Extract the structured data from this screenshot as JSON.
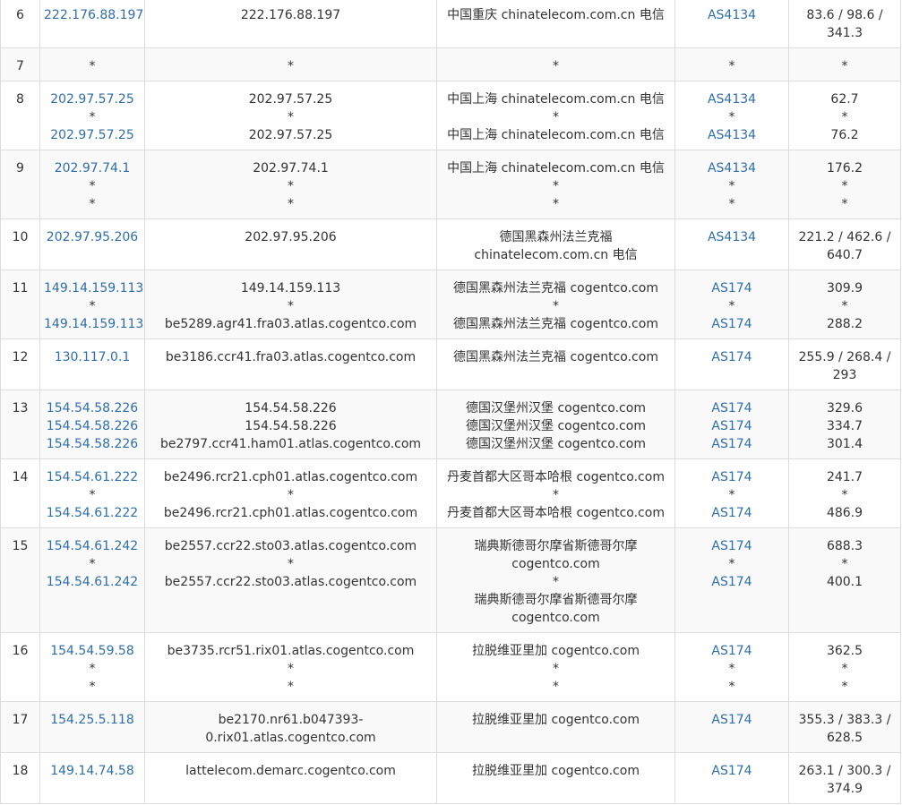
{
  "rows": [
    {
      "hop": "6",
      "ips": [
        "222.176.88.197"
      ],
      "hosts": [
        "222.176.88.197"
      ],
      "locs": [
        "中国重庆 chinatelecom.com.cn 电信"
      ],
      "asns": [
        "AS4134"
      ],
      "rtts": [
        "83.6 / 98.6 / 341.3"
      ]
    },
    {
      "hop": "7",
      "ips": [
        "*"
      ],
      "hosts": [
        "*"
      ],
      "locs": [
        "*"
      ],
      "asns": [
        "*"
      ],
      "rtts": [
        "*"
      ]
    },
    {
      "hop": "8",
      "ips": [
        "202.97.57.25",
        "*",
        "202.97.57.25"
      ],
      "hosts": [
        "202.97.57.25",
        "*",
        "202.97.57.25"
      ],
      "locs": [
        "中国上海 chinatelecom.com.cn 电信",
        "*",
        "中国上海 chinatelecom.com.cn 电信"
      ],
      "asns": [
        "AS4134",
        "*",
        "AS4134"
      ],
      "rtts": [
        "62.7",
        "*",
        "76.2"
      ]
    },
    {
      "hop": "9",
      "ips": [
        "202.97.74.1",
        "*",
        "*"
      ],
      "hosts": [
        "202.97.74.1",
        "*",
        "*"
      ],
      "locs": [
        "中国上海 chinatelecom.com.cn 电信",
        "*",
        "*"
      ],
      "asns": [
        "AS4134",
        "*",
        "*"
      ],
      "rtts": [
        "176.2",
        "*",
        "*"
      ]
    },
    {
      "hop": "10",
      "ips": [
        "202.97.95.206"
      ],
      "hosts": [
        "202.97.95.206"
      ],
      "locs": [
        "德国黑森州法兰克福 chinatelecom.com.cn 电信"
      ],
      "asns": [
        "AS4134"
      ],
      "rtts": [
        "221.2 / 462.6 / 640.7"
      ]
    },
    {
      "hop": "11",
      "ips": [
        "149.14.159.113",
        "*",
        "149.14.159.113"
      ],
      "hosts": [
        "149.14.159.113",
        "*",
        "be5289.agr41.fra03.atlas.cogentco.com"
      ],
      "locs": [
        "德国黑森州法兰克福 cogentco.com",
        "*",
        "德国黑森州法兰克福 cogentco.com"
      ],
      "asns": [
        "AS174",
        "*",
        "AS174"
      ],
      "rtts": [
        "309.9",
        "*",
        "288.2"
      ]
    },
    {
      "hop": "12",
      "ips": [
        "130.117.0.1"
      ],
      "hosts": [
        "be3186.ccr41.fra03.atlas.cogentco.com"
      ],
      "locs": [
        "德国黑森州法兰克福 cogentco.com"
      ],
      "asns": [
        "AS174"
      ],
      "rtts": [
        "255.9 / 268.4 / 293"
      ]
    },
    {
      "hop": "13",
      "ips": [
        "154.54.58.226",
        "154.54.58.226",
        "154.54.58.226"
      ],
      "hosts": [
        "154.54.58.226",
        "154.54.58.226",
        "be2797.ccr41.ham01.atlas.cogentco.com"
      ],
      "locs": [
        "德国汉堡州汉堡 cogentco.com",
        "德国汉堡州汉堡 cogentco.com",
        "德国汉堡州汉堡 cogentco.com"
      ],
      "asns": [
        "AS174",
        "AS174",
        "AS174"
      ],
      "rtts": [
        "329.6",
        "334.7",
        "301.4"
      ]
    },
    {
      "hop": "14",
      "ips": [
        "154.54.61.222",
        "*",
        "154.54.61.222"
      ],
      "hosts": [
        "be2496.rcr21.cph01.atlas.cogentco.com",
        "*",
        "be2496.rcr21.cph01.atlas.cogentco.com"
      ],
      "locs": [
        "丹麦首都大区哥本哈根 cogentco.com",
        "*",
        "丹麦首都大区哥本哈根 cogentco.com"
      ],
      "asns": [
        "AS174",
        "*",
        "AS174"
      ],
      "rtts": [
        "241.7",
        "*",
        "486.9"
      ]
    },
    {
      "hop": "15",
      "ips": [
        "154.54.61.242",
        "*",
        "154.54.61.242"
      ],
      "hosts": [
        "be2557.ccr22.sto03.atlas.cogentco.com",
        "*",
        "be2557.ccr22.sto03.atlas.cogentco.com"
      ],
      "locs": [
        "瑞典斯德哥尔摩省斯德哥尔摩 cogentco.com",
        "*",
        "瑞典斯德哥尔摩省斯德哥尔摩 cogentco.com"
      ],
      "asns": [
        "AS174",
        "*",
        "AS174"
      ],
      "rtts": [
        "688.3",
        "*",
        "400.1"
      ]
    },
    {
      "hop": "16",
      "ips": [
        "154.54.59.58",
        "*",
        "*"
      ],
      "hosts": [
        "be3735.rcr51.rix01.atlas.cogentco.com",
        "*",
        "*"
      ],
      "locs": [
        "拉脱维亚里加 cogentco.com",
        "*",
        "*"
      ],
      "asns": [
        "AS174",
        "*",
        "*"
      ],
      "rtts": [
        "362.5",
        "*",
        "*"
      ]
    },
    {
      "hop": "17",
      "ips": [
        "154.25.5.118"
      ],
      "hosts": [
        "be2170.nr61.b047393-0.rix01.atlas.cogentco.com"
      ],
      "locs": [
        "拉脱维亚里加 cogentco.com"
      ],
      "asns": [
        "AS174"
      ],
      "rtts": [
        "355.3 / 383.3 / 628.5"
      ]
    },
    {
      "hop": "18",
      "ips": [
        "149.14.74.58"
      ],
      "hosts": [
        "lattelecom.demarc.cogentco.com"
      ],
      "locs": [
        "拉脱维亚里加 cogentco.com"
      ],
      "asns": [
        "AS174"
      ],
      "rtts": [
        "263.1 / 300.3 / 374.9"
      ]
    }
  ]
}
